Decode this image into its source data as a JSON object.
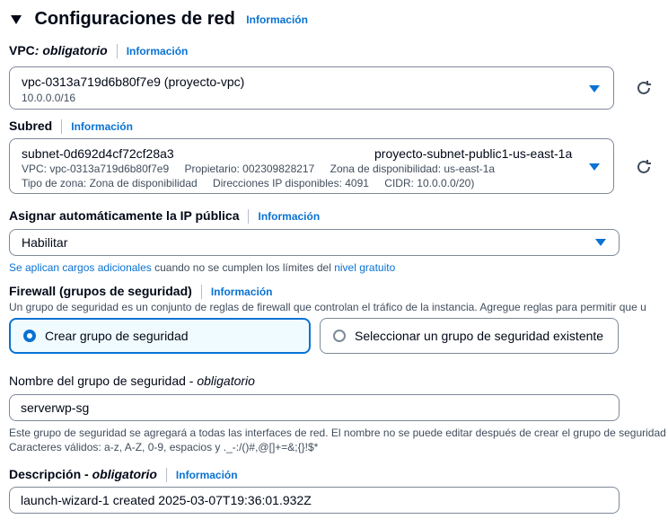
{
  "section": {
    "title": "Configuraciones de red",
    "info": "Información"
  },
  "vpc": {
    "label": "VPC",
    "required": ": obligatorio",
    "info": "Información",
    "value": "vpc-0313a719d6b80f7e9 (proyecto-vpc)",
    "cidr": "10.0.0.0/16"
  },
  "subnet": {
    "label": "Subred",
    "info": "Información",
    "id": "subnet-0d692d4cf72cf28a3",
    "name": "proyecto-subnet-public1-us-east-1a",
    "vpc": "VPC: vpc-0313a719d6b80f7e9",
    "owner": "Propietario: 002309828217",
    "zone": "Zona de disponibilidad: us-east-1a",
    "zone_type": "Tipo de zona: Zona de disponibilidad",
    "ips": "Direcciones IP disponibles: 4091",
    "cidr": "CIDR: 10.0.0.0/20)"
  },
  "public_ip": {
    "label": "Asignar automáticamente la IP pública",
    "info": "Información",
    "value": "Habilitar",
    "note_link1": "Se aplican cargos adicionales",
    "note_text": " cuando no se cumplen los límites del ",
    "note_link2": "nivel gratuito"
  },
  "firewall": {
    "label": "Firewall (grupos de seguridad)",
    "info": "Información",
    "desc": "Un grupo de seguridad es un conjunto de reglas de firewall que controlan el tráfico de la instancia. Agregue reglas para permitir que u",
    "option_create": "Crear grupo de seguridad",
    "option_select": "Seleccionar un grupo de seguridad existente"
  },
  "sg_name": {
    "label": "Nombre del grupo de seguridad - ",
    "required": "obligatorio",
    "value": "serverwp-sg",
    "help1": "Este grupo de seguridad se agregará a todas las interfaces de red. El nombre no se puede editar después de crear el grupo de seguridad",
    "help2": "Caracteres válidos: a-z, A-Z, 0-9, espacios y ._-:/()#,@[]+=&;{}!$*"
  },
  "description": {
    "label": "Descripción - ",
    "required": "obligatorio",
    "info": "Información",
    "value": "launch-wizard-1 created 2025-03-07T19:36:01.932Z"
  },
  "colors": {
    "accent": "#0972d3",
    "border": "#7d8998",
    "text": "#000716"
  }
}
